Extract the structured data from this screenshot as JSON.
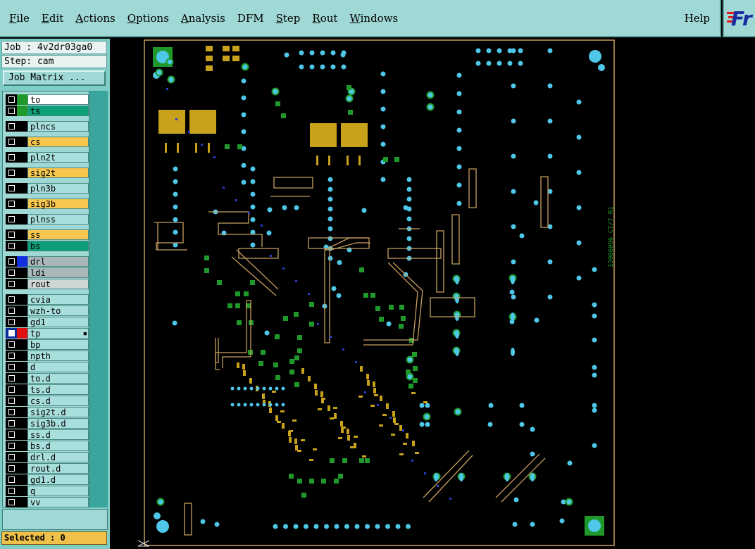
{
  "menubar": {
    "items": [
      {
        "label": "File",
        "underline": "F",
        "rest": "ile"
      },
      {
        "label": "Edit",
        "underline": "E",
        "rest": "dit"
      },
      {
        "label": "Actions",
        "underline": "A",
        "rest": "ctions"
      },
      {
        "label": "Options",
        "underline": "O",
        "rest": "ptions"
      },
      {
        "label": "Analysis",
        "underline": "A",
        "rest": "nalysis"
      },
      {
        "label": "DFM",
        "underline": "",
        "rest": "DFM"
      },
      {
        "label": "Step",
        "underline": "S",
        "rest": "tep"
      },
      {
        "label": "Rout",
        "underline": "R",
        "rest": "out"
      },
      {
        "label": "Windows",
        "underline": "W",
        "rest": "indows"
      }
    ],
    "help": "Help",
    "logo": "Fr"
  },
  "job": {
    "label": "Job : 4v2dr03ga0"
  },
  "step": {
    "label": "Step: cam"
  },
  "job_matrix": {
    "label": "Job Matrix ..."
  },
  "colors": {
    "panel": "#7ecdc6",
    "menubar": "#9fd8d4",
    "signal_orange": "#f7c64f",
    "signal_green": "#0e9e78",
    "drill_gray": "#a9b7b8",
    "pad_cyan": "#4fc7e8",
    "pad_green": "#1f9a2a",
    "copper_gold": "#c8a21a",
    "outline": "#c8a060"
  },
  "layers": [
    {
      "name": "to",
      "swatch": "#1f9a2a",
      "bg": "#ffffff",
      "group": 1
    },
    {
      "name": "ts",
      "swatch": "#1f9a2a",
      "bg": "#0e9e78",
      "group": 1
    },
    {
      "name": "plncs",
      "swatch": "#000000",
      "bg": "#a8dedb",
      "group": 2
    },
    {
      "name": "cs",
      "swatch": "#000000",
      "bg": "#f7c64f",
      "group": 3
    },
    {
      "name": "pln2t",
      "swatch": "#000000",
      "bg": "#a8dedb",
      "group": 4
    },
    {
      "name": "sig2t",
      "swatch": "#000000",
      "bg": "#f7c64f",
      "group": 5
    },
    {
      "name": "pln3b",
      "swatch": "#000000",
      "bg": "#a8dedb",
      "group": 6
    },
    {
      "name": "sig3b",
      "swatch": "#000000",
      "bg": "#f7c64f",
      "group": 7
    },
    {
      "name": "plnss",
      "swatch": "#000000",
      "bg": "#a8dedb",
      "group": 8
    },
    {
      "name": "ss",
      "swatch": "#000000",
      "bg": "#f7c64f",
      "group": 9
    },
    {
      "name": "bs",
      "swatch": "#000000",
      "bg": "#0e9e78",
      "group": 9
    },
    {
      "name": "drl",
      "swatch": "#1030e0",
      "bg": "#a9b7b8",
      "group": 10
    },
    {
      "name": "ldi",
      "swatch": "#000000",
      "bg": "#a9b7b8",
      "group": 10
    },
    {
      "name": "rout",
      "swatch": "#000000",
      "bg": "#cfd6d6",
      "group": 10
    },
    {
      "name": "cvia",
      "swatch": "#000000",
      "bg": "#a8dedb",
      "group": 11
    },
    {
      "name": "wzh-to",
      "swatch": "#000000",
      "bg": "#a8dedb",
      "group": 11
    },
    {
      "name": "gd1",
      "swatch": "#000000",
      "bg": "#a8dedb",
      "group": 11
    },
    {
      "name": "tp",
      "swatch": "#e01010",
      "bg": "#a8dedb",
      "group": 11,
      "selected": true,
      "mark": true
    },
    {
      "name": "bp",
      "swatch": "#000000",
      "bg": "#a8dedb",
      "group": 11
    },
    {
      "name": "npth",
      "swatch": "#000000",
      "bg": "#a8dedb",
      "group": 11
    },
    {
      "name": "d",
      "swatch": "#000000",
      "bg": "#a8dedb",
      "group": 11
    },
    {
      "name": "to.d",
      "swatch": "#000000",
      "bg": "#a8dedb",
      "group": 11
    },
    {
      "name": "ts.d",
      "swatch": "#000000",
      "bg": "#a8dedb",
      "group": 11
    },
    {
      "name": "cs.d",
      "swatch": "#000000",
      "bg": "#a8dedb",
      "group": 11
    },
    {
      "name": "sig2t.d",
      "swatch": "#000000",
      "bg": "#a8dedb",
      "group": 11
    },
    {
      "name": "sig3b.d",
      "swatch": "#000000",
      "bg": "#a8dedb",
      "group": 11
    },
    {
      "name": "ss.d",
      "swatch": "#000000",
      "bg": "#a8dedb",
      "group": 11
    },
    {
      "name": "bs.d",
      "swatch": "#000000",
      "bg": "#a8dedb",
      "group": 11
    },
    {
      "name": "drl.d",
      "swatch": "#000000",
      "bg": "#a8dedb",
      "group": 11
    },
    {
      "name": "rout.d",
      "swatch": "#000000",
      "bg": "#a8dedb",
      "group": 11
    },
    {
      "name": "gd1.d",
      "swatch": "#000000",
      "bg": "#a8dedb",
      "group": 11
    },
    {
      "name": "q",
      "swatch": "#000000",
      "bg": "#a8dedb",
      "group": 11
    },
    {
      "name": "vv",
      "swatch": "#000000",
      "bg": "#a8dedb",
      "group": 11
    }
  ],
  "selected": {
    "label": "Selected : 0"
  },
  "board": {
    "side_text": "130B6096 CT/7 R1"
  }
}
